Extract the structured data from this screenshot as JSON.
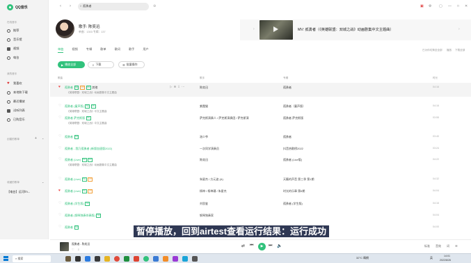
{
  "app": {
    "name": "QQ音乐"
  },
  "sidebar": {
    "online_section": "在线音乐",
    "online_items": [
      {
        "label": "推荐"
      },
      {
        "label": "音乐馆"
      },
      {
        "label": "视频"
      },
      {
        "label": "电台"
      }
    ],
    "mine_section": "我的音乐",
    "mine_items": [
      {
        "label": "我喜欢"
      },
      {
        "label": "本地和下载"
      },
      {
        "label": "最近播放"
      },
      {
        "label": "试听列表"
      },
      {
        "label": "已购音乐"
      }
    ],
    "created_section": "创建的歌单",
    "collected_section": "收藏的歌单",
    "collected_items": [
      {
        "label": "【电台】运河fm..."
      }
    ]
  },
  "search": {
    "value": "孤勇者"
  },
  "artist": {
    "name": "歌手: 陈奕迅",
    "stats": "单曲：1303    专辑：137"
  },
  "promo": {
    "title": "MV: 孤勇者（《英雄联盟：双城之战》动画剧集中文主题曲）"
  },
  "tabs": [
    {
      "label": "单曲"
    },
    {
      "label": "视频"
    },
    {
      "label": "专辑"
    },
    {
      "label": "歌单"
    },
    {
      "label": "歌词"
    },
    {
      "label": "歌手"
    },
    {
      "label": "用户"
    }
  ],
  "tab_right": [
    "已为你切换至全部",
    "播放",
    "下载全部"
  ],
  "actions": {
    "play_all": "播放全部",
    "download": "下载",
    "batch": "批量操作"
  },
  "table": {
    "headers": {
      "song": "歌曲",
      "artist": "歌手",
      "album": "专辑",
      "duration": "时长"
    },
    "rows": [
      {
        "title": "孤勇者",
        "tags": [
          "SQ",
          "VIP",
          "MV"
        ],
        "extra": "其他",
        "sub": "《英雄联盟：双城之战》动画剧集中文主题曲",
        "artist": "陈奕迅",
        "album": "孤勇者",
        "duration": "04:16",
        "liked": true,
        "highlight": true
      },
      {
        "title": "孤勇者 (童声版)",
        "tags": [
          "SQ",
          "MV"
        ],
        "sub": "《英雄联盟：双城之战》中文主题曲",
        "artist": "紫霞猫",
        "album": "孤勇者（童声版）",
        "duration": "04:16",
        "liked": false
      },
      {
        "title": "孤勇者 萨克斯版",
        "tags": [
          "SQ"
        ],
        "sub": "《英雄联盟：双城之战》中文主题曲",
        "artist": "萨克斯演奏人 / 萨克斯演奏团 / 萨克斯演",
        "album": "孤勇者 萨克斯版",
        "duration": "03:55",
        "liked": false
      },
      {
        "title": "孤勇者",
        "tags": [
          "SQ"
        ],
        "artist": "洛少爷",
        "album": "孤勇者",
        "duration": "03:40",
        "liked": false
      },
      {
        "title": "孤勇者 - 我乃孤勇者 (新版加速版2022)",
        "tags": [],
        "artist": "一次同学演奏员",
        "album": "抖音热歌榜2022",
        "duration": "03:24",
        "liked": false
      },
      {
        "title": "孤勇者 (Live)",
        "tags": [
          "SQ",
          "MV"
        ],
        "sub": "《英雄联盟：双城之战》动画剧集中文主题曲",
        "artist": "陈奕迅",
        "album": "孤勇者 (Live版)",
        "duration": "04:22",
        "liked": false
      },
      {
        "title": "孤勇者 (Live)",
        "tags": [
          "SQ",
          "VIP"
        ],
        "artist": "朱星杰 / 方元波 (A)",
        "album": "天籁的声音 第三季 第1期",
        "duration": "04:32",
        "liked": false
      },
      {
        "title": "孤勇者 (Live)",
        "tags": [
          "SQ",
          "VIP"
        ],
        "artist": "杨坤 / 杨坤珊 / 朱星杰",
        "album": "时光的乐章 第6期",
        "duration": "04:04",
        "liked": true
      },
      {
        "title": "孤勇者 (学生版)",
        "tags": [
          "SQ"
        ],
        "artist": "刘思鉴",
        "album": "孤勇者 (学生版)",
        "duration": "04:16",
        "liked": false
      },
      {
        "title": "孤勇者 (钢琴独奏伴奏版)",
        "tags": [
          "SQ"
        ],
        "artist": "钢琴独奏家",
        "album": "",
        "duration": "04:04",
        "liked": false
      },
      {
        "title": "孤勇者",
        "tags": [
          "SQ"
        ],
        "artist": "",
        "album": "",
        "duration": "04:00",
        "liked": false
      }
    ]
  },
  "player": {
    "title": "孤勇者 - 陈奕迅",
    "right": [
      "标准",
      "音效",
      "词"
    ]
  },
  "caption": "暂停播放，回到airtest查看运行结果：运行成功",
  "taskbar": {
    "search": "搜索",
    "weather": "32°C 晴朗",
    "lang": "英",
    "time": "14:01",
    "date": "2022/8/26"
  }
}
